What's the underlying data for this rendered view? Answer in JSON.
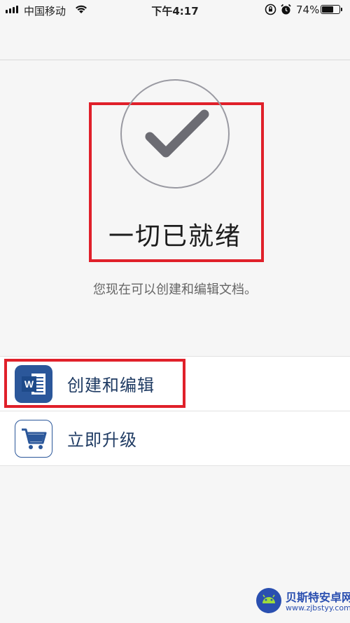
{
  "status_bar": {
    "carrier": "中国移动",
    "time": "下午4:17",
    "battery_percent": "74%",
    "battery_level": 0.74,
    "icons": [
      "signal-icon",
      "wifi-icon",
      "rotation-lock-icon",
      "alarm-icon",
      "battery-icon"
    ]
  },
  "hero": {
    "title": "一切已就绪",
    "subtitle": "您现在可以创建和编辑文档。",
    "icon": "checkmark-icon"
  },
  "list": {
    "items": [
      {
        "label": "创建和编辑",
        "icon": "word-app-icon"
      },
      {
        "label": "立即升级",
        "icon": "shopping-cart-icon"
      }
    ]
  },
  "watermark": {
    "name": "贝斯特安卓网",
    "url": "www.zjbstyy.com"
  },
  "colors": {
    "highlight": "#e0202a",
    "word_blue": "#2b579a",
    "label_text": "#1f3b63"
  }
}
